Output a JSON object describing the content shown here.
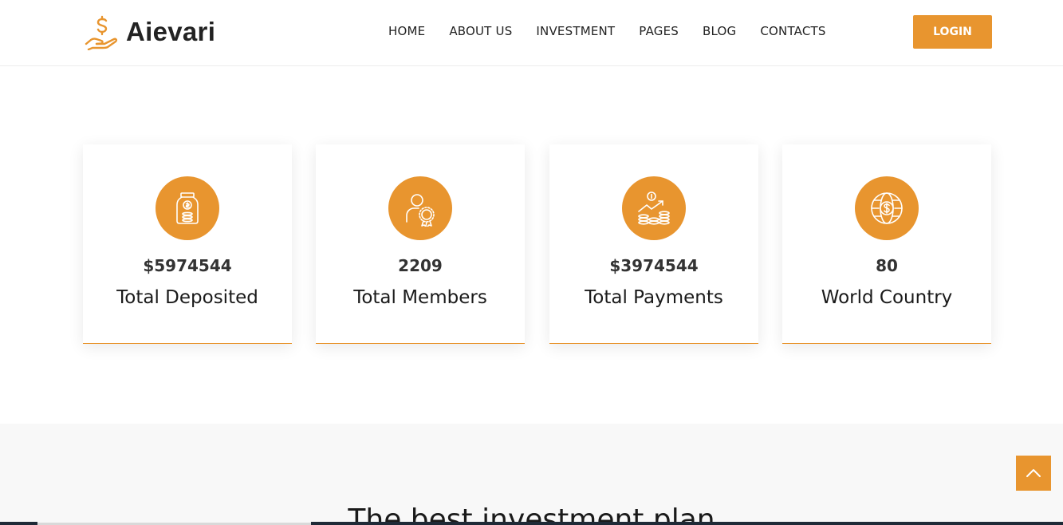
{
  "brand": {
    "name": "Aievari",
    "logo_icon": "dollar-hand-icon",
    "accent": "#e8952f"
  },
  "nav": {
    "items": [
      {
        "label": "HOME"
      },
      {
        "label": "ABOUT US"
      },
      {
        "label": "INVESTMENT"
      },
      {
        "label": "PAGES"
      },
      {
        "label": "BLOG"
      },
      {
        "label": "CONTACTS"
      }
    ],
    "login_label": "LOGIN"
  },
  "stats": [
    {
      "icon": "money-jar-icon",
      "value": "$5974544",
      "label": "Total Deposited"
    },
    {
      "icon": "member-award-icon",
      "value": "2209",
      "label": "Total Members"
    },
    {
      "icon": "coins-growth-icon",
      "value": "$3974544",
      "label": "Total Payments"
    },
    {
      "icon": "globe-dollar-icon",
      "value": "80",
      "label": "World Country"
    }
  ],
  "section2": {
    "title": "The best investment plan"
  },
  "scroll_top": {
    "icon": "chevron-up-icon"
  }
}
